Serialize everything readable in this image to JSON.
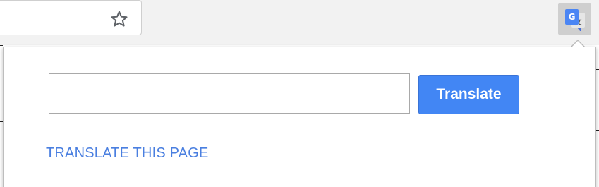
{
  "toolbar": {
    "bookmark_icon": "star-outline-icon",
    "extension_icon": "google-translate-icon"
  },
  "popup": {
    "input_value": "",
    "input_placeholder": "",
    "translate_button_label": "Translate",
    "translate_page_link": "TRANSLATE THIS PAGE"
  },
  "colors": {
    "accent": "#4286f4",
    "link": "#4a7fe0",
    "toolbar_bg": "#f2f2f2"
  }
}
